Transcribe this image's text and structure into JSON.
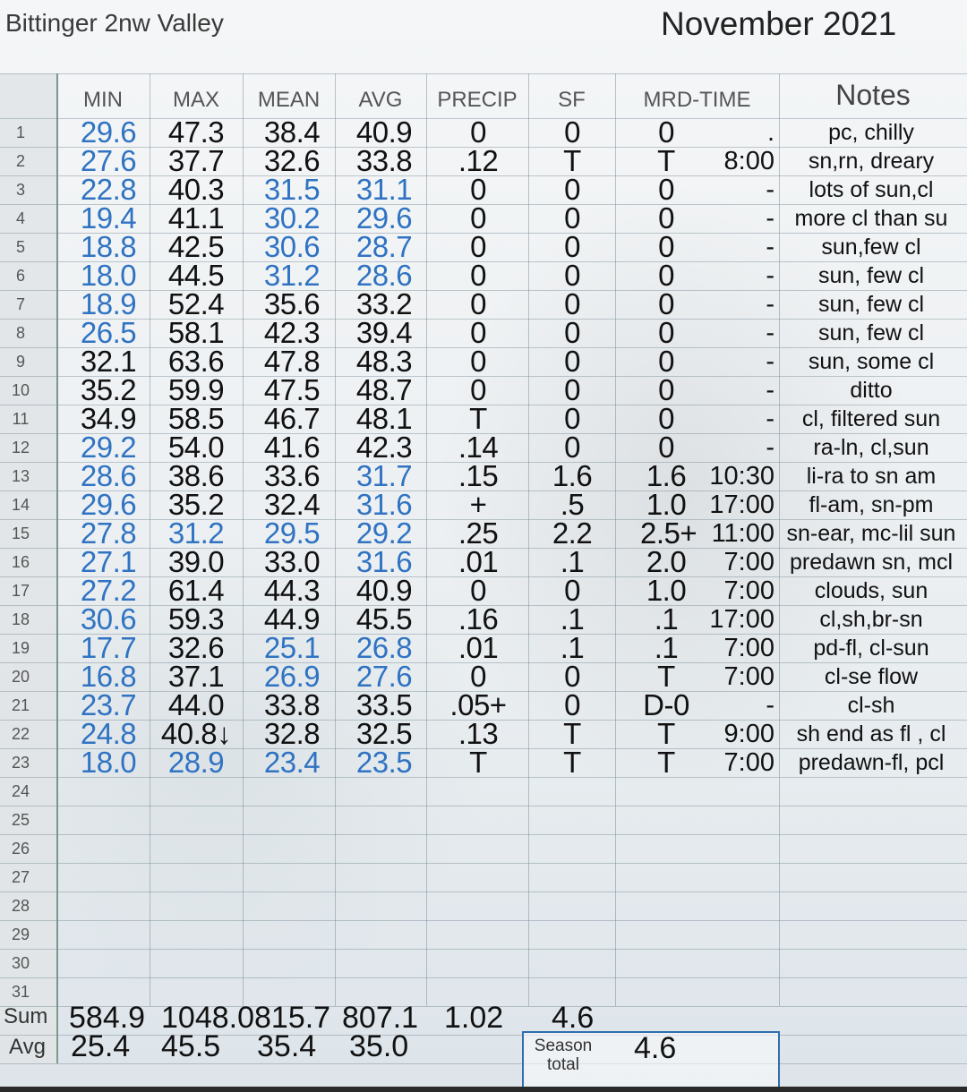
{
  "header": {
    "station": "Bittinger 2nw Valley",
    "month": "November 2021"
  },
  "columns": [
    "MIN",
    "MAX",
    "MEAN",
    "AVG",
    "PRECIP",
    "SF",
    "MRD-TIME"
  ],
  "notes_header": "Notes",
  "row_numbers": [
    "1",
    "2",
    "3",
    "4",
    "5",
    "6",
    "7",
    "8",
    "9",
    "10",
    "11",
    "12",
    "13",
    "14",
    "15",
    "16",
    "17",
    "18",
    "19",
    "20",
    "21",
    "22",
    "23",
    "24",
    "25",
    "26",
    "27",
    "28",
    "29",
    "30",
    "31"
  ],
  "rows": [
    {
      "min": "29.6",
      "max": "47.3",
      "mean": "38.4",
      "avg": "40.9",
      "precip": "0",
      "sf": "0",
      "mrd": "0",
      "time": ".",
      "note": "pc, chilly"
    },
    {
      "min": "27.6",
      "max": "37.7",
      "mean": "32.6",
      "avg": "33.8",
      "precip": ".12",
      "sf": "T",
      "mrd": "T",
      "time": "8:00",
      "note": "sn,rn, dreary"
    },
    {
      "min": "22.8",
      "max": "40.3",
      "mean": "31.5",
      "avg": "31.1",
      "precip": "0",
      "sf": "0",
      "mrd": "0",
      "time": "-",
      "note": "lots of sun,cl"
    },
    {
      "min": "19.4",
      "max": "41.1",
      "mean": "30.2",
      "avg": "29.6",
      "precip": "0",
      "sf": "0",
      "mrd": "0",
      "time": "-",
      "note": "more cl than su"
    },
    {
      "min": "18.8",
      "max": "42.5",
      "mean": "30.6",
      "avg": "28.7",
      "precip": "0",
      "sf": "0",
      "mrd": "0",
      "time": "-",
      "note": "sun,few cl"
    },
    {
      "min": "18.0",
      "max": "44.5",
      "mean": "31.2",
      "avg": "28.6",
      "precip": "0",
      "sf": "0",
      "mrd": "0",
      "time": "-",
      "note": "sun, few cl"
    },
    {
      "min": "18.9",
      "max": "52.4",
      "mean": "35.6",
      "avg": "33.2",
      "precip": "0",
      "sf": "0",
      "mrd": "0",
      "time": "-",
      "note": "sun, few cl"
    },
    {
      "min": "26.5",
      "max": "58.1",
      "mean": "42.3",
      "avg": "39.4",
      "precip": "0",
      "sf": "0",
      "mrd": "0",
      "time": "-",
      "note": "sun, few cl"
    },
    {
      "min": "32.1",
      "max": "63.6",
      "mean": "47.8",
      "avg": "48.3",
      "precip": "0",
      "sf": "0",
      "mrd": "0",
      "time": "-",
      "note": "sun, some cl"
    },
    {
      "min": "35.2",
      "max": "59.9",
      "mean": "47.5",
      "avg": "48.7",
      "precip": "0",
      "sf": "0",
      "mrd": "0",
      "time": "-",
      "note": "ditto"
    },
    {
      "min": "34.9",
      "max": "58.5",
      "mean": "46.7",
      "avg": "48.1",
      "precip": "T",
      "sf": "0",
      "mrd": "0",
      "time": "-",
      "note": "cl, filtered sun"
    },
    {
      "min": "29.2",
      "max": "54.0",
      "mean": "41.6",
      "avg": "42.3",
      "precip": ".14",
      "sf": "0",
      "mrd": "0",
      "time": "-",
      "note": "ra-ln, cl,sun"
    },
    {
      "min": "28.6",
      "max": "38.6",
      "mean": "33.6",
      "avg": "31.7",
      "precip": ".15",
      "sf": "1.6",
      "mrd": "1.6",
      "time": "10:30",
      "note": "li-ra to sn am"
    },
    {
      "min": "29.6",
      "max": "35.2",
      "mean": "32.4",
      "avg": "31.6",
      "precip": "+",
      "sf": ".5",
      "mrd": "1.0",
      "time": "17:00",
      "note": "fl-am, sn-pm"
    },
    {
      "min": "27.8",
      "max": "31.2",
      "mean": "29.5",
      "avg": "29.2",
      "precip": ".25",
      "sf": "2.2",
      "mrd": "2.5+",
      "time": "11:00",
      "note": "sn-ear, mc-lil sun"
    },
    {
      "min": "27.1",
      "max": "39.0",
      "mean": "33.0",
      "avg": "31.6",
      "precip": ".01",
      "sf": ".1",
      "mrd": "2.0",
      "time": "7:00",
      "note": "predawn sn, mcl"
    },
    {
      "min": "27.2",
      "max": "61.4",
      "mean": "44.3",
      "avg": "40.9",
      "precip": "0",
      "sf": "0",
      "mrd": "1.0",
      "time": "7:00",
      "note": "clouds, sun"
    },
    {
      "min": "30.6",
      "max": "59.3",
      "mean": "44.9",
      "avg": "45.5",
      "precip": ".16",
      "sf": ".1",
      "mrd": ".1",
      "time": "17:00",
      "note": "cl,sh,br-sn"
    },
    {
      "min": "17.7",
      "max": "32.6",
      "mean": "25.1",
      "avg": "26.8",
      "precip": ".01",
      "sf": ".1",
      "mrd": ".1",
      "time": "7:00",
      "note": "pd-fl, cl-sun"
    },
    {
      "min": "16.8",
      "max": "37.1",
      "mean": "26.9",
      "avg": "27.6",
      "precip": "0",
      "sf": "0",
      "mrd": "T",
      "time": "7:00",
      "note": "cl-se flow"
    },
    {
      "min": "23.7",
      "max": "44.0",
      "mean": "33.8",
      "avg": "33.5",
      "precip": ".05+",
      "sf": "0",
      "mrd": "D-0",
      "time": "-",
      "note": "cl-sh"
    },
    {
      "min": "24.8",
      "max": "40.8↓",
      "mean": "32.8",
      "avg": "32.5",
      "precip": ".13",
      "sf": "T",
      "mrd": "T",
      "time": "9:00",
      "note": "sh end as fl , cl"
    },
    {
      "min": "18.0",
      "max": "28.9",
      "mean": "23.4",
      "avg": "23.5",
      "precip": "T",
      "sf": "T",
      "mrd": "T",
      "time": "7:00",
      "note": "predawn-fl, pcl"
    }
  ],
  "colors": {
    "min": [
      "blue",
      "blue",
      "blue",
      "blue",
      "blue",
      "blue",
      "blue",
      "blue",
      "black",
      "black",
      "black",
      "blue",
      "blue",
      "blue",
      "blue",
      "blue",
      "blue",
      "blue",
      "blue",
      "blue",
      "blue",
      "blue",
      "blue"
    ],
    "max": [
      "black",
      "black",
      "black",
      "black",
      "black",
      "black",
      "black",
      "black",
      "black",
      "black",
      "black",
      "black",
      "black",
      "black",
      "blue",
      "black",
      "black",
      "black",
      "black",
      "black",
      "black",
      "black",
      "blue"
    ],
    "mean": [
      "black",
      "black",
      "blue",
      "blue",
      "blue",
      "blue",
      "black",
      "black",
      "black",
      "black",
      "black",
      "black",
      "black",
      "black",
      "blue",
      "black",
      "black",
      "black",
      "blue",
      "blue",
      "black",
      "black",
      "blue"
    ],
    "avg": [
      "black",
      "black",
      "blue",
      "blue",
      "blue",
      "blue",
      "black",
      "black",
      "black",
      "black",
      "black",
      "black",
      "blue",
      "blue",
      "blue",
      "blue",
      "black",
      "black",
      "blue",
      "blue",
      "black",
      "black",
      "blue"
    ],
    "blue_hex": "#2f73c2"
  },
  "summary": {
    "sum_label": "Sum",
    "avg_label": "Avg",
    "sum_min": "584.9",
    "sum_max": "1048.0",
    "sum_mean": "815.7",
    "sum_avg": "807.1",
    "sum_precip": "1.02",
    "sum_sf": "4.6",
    "avg_min": "25.4",
    "avg_max": "45.5",
    "avg_mean": "35.4",
    "avg_avg": "35.0",
    "season_label": "Season total",
    "season_value": "4.6"
  }
}
